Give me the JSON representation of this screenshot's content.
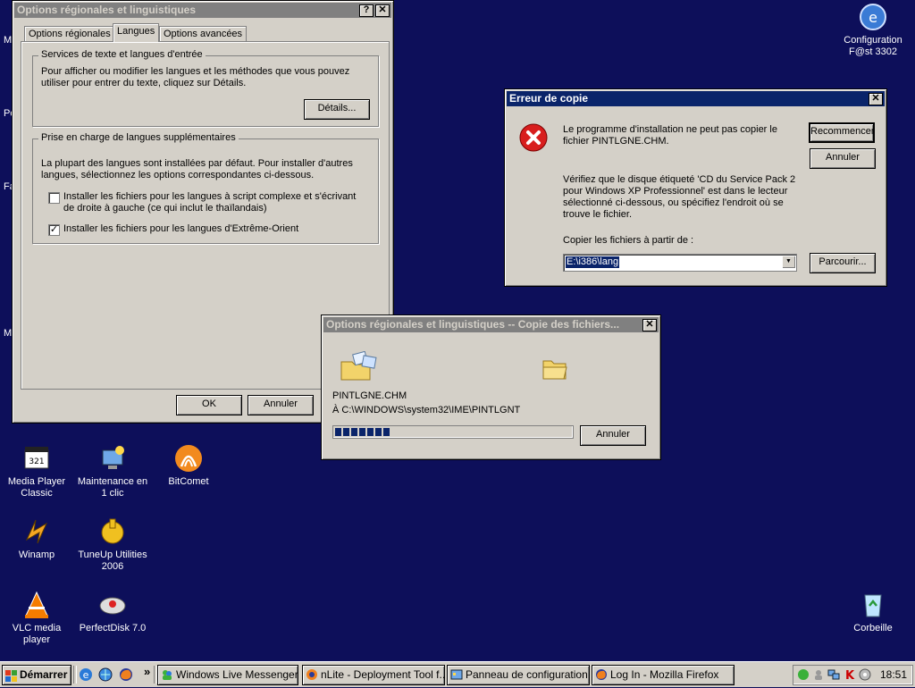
{
  "desktop": {
    "icons": [
      {
        "label": "Configuration F@st 3302",
        "icon": "network-config-icon"
      },
      {
        "label": "Media Player Classic",
        "icon": "media-player-icon"
      },
      {
        "label": "Maintenance en 1 clic",
        "icon": "maintenance-icon"
      },
      {
        "label": "BitComet",
        "icon": "bitcomet-icon"
      },
      {
        "label": "Winamp",
        "icon": "winamp-icon"
      },
      {
        "label": "TuneUp Utilities 2006",
        "icon": "tuneup-icon"
      },
      {
        "label": "VLC media player",
        "icon": "vlc-icon"
      },
      {
        "label": "PerfectDisk 7.0",
        "icon": "perfectdisk-icon"
      },
      {
        "label": "Corbeille",
        "icon": "recycle-bin-icon"
      }
    ],
    "edge_letters": [
      "M",
      "Po",
      "Fa",
      "M"
    ]
  },
  "regional_dialog": {
    "title": "Options régionales et linguistiques",
    "help_btn": "?",
    "close_btn": "✕",
    "tabs": [
      "Options régionales",
      "Langues",
      "Options avancées"
    ],
    "active_tab": "Langues",
    "group1": {
      "label": "Services de texte et langues d'entrée",
      "text": "Pour afficher ou modifier les langues et les méthodes que vous pouvez utiliser pour entrer du texte, cliquez sur Détails.",
      "details_btn": "Détails..."
    },
    "group2": {
      "label": "Prise en charge de langues supplémentaires",
      "text": "La plupart des langues sont installées par défaut. Pour installer d'autres langues, sélectionnez les options correspondantes ci-dessous.",
      "check1": {
        "label": "Installer les fichiers pour les langues à script complexe et s'écrivant de droite à gauche (ce qui inclut le thaïlandais)",
        "checked": false
      },
      "check2": {
        "label": "Installer les fichiers pour les langues d'Extrême-Orient",
        "checked": true
      }
    },
    "ok_btn": "OK",
    "cancel_btn": "Annuler"
  },
  "error_dialog": {
    "title": "Erreur de copie",
    "close_btn": "✕",
    "message1": "Le programme d'installation ne peut pas copier le fichier PINTLGNE.CHM.",
    "message2": "Vérifiez que le disque étiqueté 'CD du Service Pack 2 pour Windows XP Professionnel' est dans le lecteur sélectionné ci-dessous, ou spécifiez l'endroit où se trouve le fichier.",
    "copy_from_label": "Copier les fichiers à partir de :",
    "copy_from_value": "E:\\i386\\lang",
    "retry_btn": "Recommencer",
    "cancel_btn": "Annuler",
    "browse_btn": "Parcourir..."
  },
  "copy_dialog": {
    "title": "Options régionales et linguistiques -- Copie des fichiers...",
    "close_btn": "✕",
    "filename": "PINTLGNE.CHM",
    "destination": "À C:\\WINDOWS\\system32\\IME\\PINTLGNT",
    "progress": 0.24,
    "cancel_btn": "Annuler"
  },
  "taskbar": {
    "start_label": "Démarrer",
    "quick_launch": [
      "ie-icon",
      "desktop-icon",
      "firefox-icon"
    ],
    "chevron": "»",
    "tasks": [
      {
        "label": "Windows Live Messenger",
        "icon": "messenger-icon"
      },
      {
        "label": "nLite - Deployment Tool f...",
        "icon": "nlite-icon"
      },
      {
        "label": "Panneau de configuration",
        "icon": "control-panel-icon"
      },
      {
        "label": "Log In - Mozilla Firefox",
        "icon": "firefox-icon"
      }
    ],
    "clock": "18:51"
  }
}
